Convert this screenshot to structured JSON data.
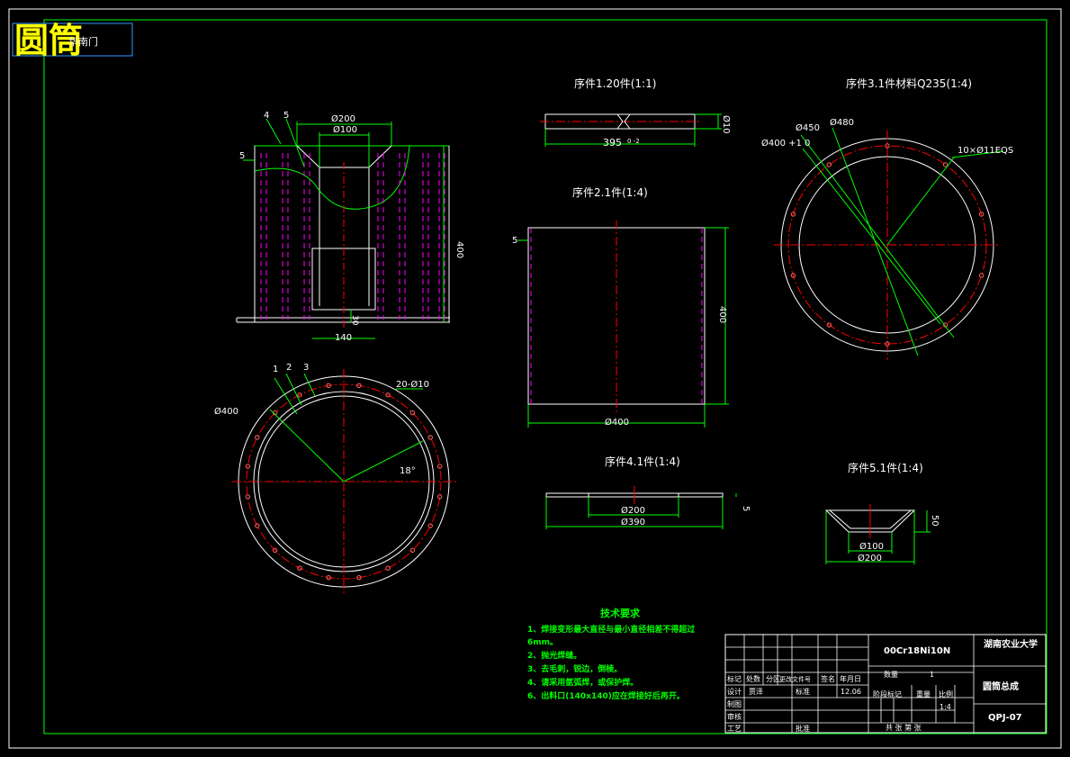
{
  "title": "圆筒",
  "title_small": "华南门",
  "views": {
    "part1": {
      "caption": "序件1.20件(1:1)",
      "dim_len": "395",
      "dim_tol": "0\n-2",
      "dim_dia": "Ø10"
    },
    "part3": {
      "caption": "序件3.1件材料Q235(1:4)",
      "d450": "Ø450",
      "d480": "Ø480",
      "d400": "Ø400 +1\n0",
      "holes": "10×Ø11EQS"
    },
    "part2": {
      "caption": "序件2.1件(1:4)",
      "h400": "400",
      "d400": "Ø400",
      "t5": "5"
    },
    "part4": {
      "caption": "序件4.1件(1:4)",
      "d200": "Ø200",
      "d390": "Ø390",
      "t5": "5"
    },
    "part5": {
      "caption": "序件5.1件(1:4)",
      "d100": "Ø100",
      "d200": "Ø200",
      "h50": "50"
    },
    "main": {
      "d200": "Ø200",
      "d100": "Ø100",
      "h400": "400",
      "w140": "140",
      "h30": "30",
      "t5": "5",
      "n4": "4",
      "n5": "5"
    },
    "plan": {
      "n1": "1",
      "n2": "2",
      "n3": "3",
      "holes": "20-Ø10",
      "d400": "Ø400",
      "ang": "18°"
    }
  },
  "tech": {
    "heading": "技术要求",
    "lines": [
      "1、焊接变形最大直径与最小直径相差不得超过",
      "6mm。",
      "2、抛光焊缝。",
      "3、去毛刺，锐边，倒棱。",
      "4、请采用氩弧焊，或保护焊。",
      "6、出料口(140x140)应在焊接好后再开。"
    ]
  },
  "titleblock": {
    "material": "00Cr18Ni10N",
    "school": "湖南农业大学",
    "drawing_name": "圆筒总成",
    "drawing_no": "QPJ-07",
    "qty_label": "数量",
    "qty": "1",
    "row_labels": [
      "标记",
      "处数",
      "分区",
      "更改文件号",
      "签名",
      "年月日"
    ],
    "design": "设计",
    "designer": "贾泽",
    "standard": "标准",
    "date": "12.06",
    "stage": "阶段标记",
    "weight": "重量",
    "scale": "比例",
    "scale_val": "1:4",
    "draw": "制图",
    "check": "审核",
    "process": "工艺",
    "approve": "批准",
    "sheets": "共  张  第  张"
  }
}
